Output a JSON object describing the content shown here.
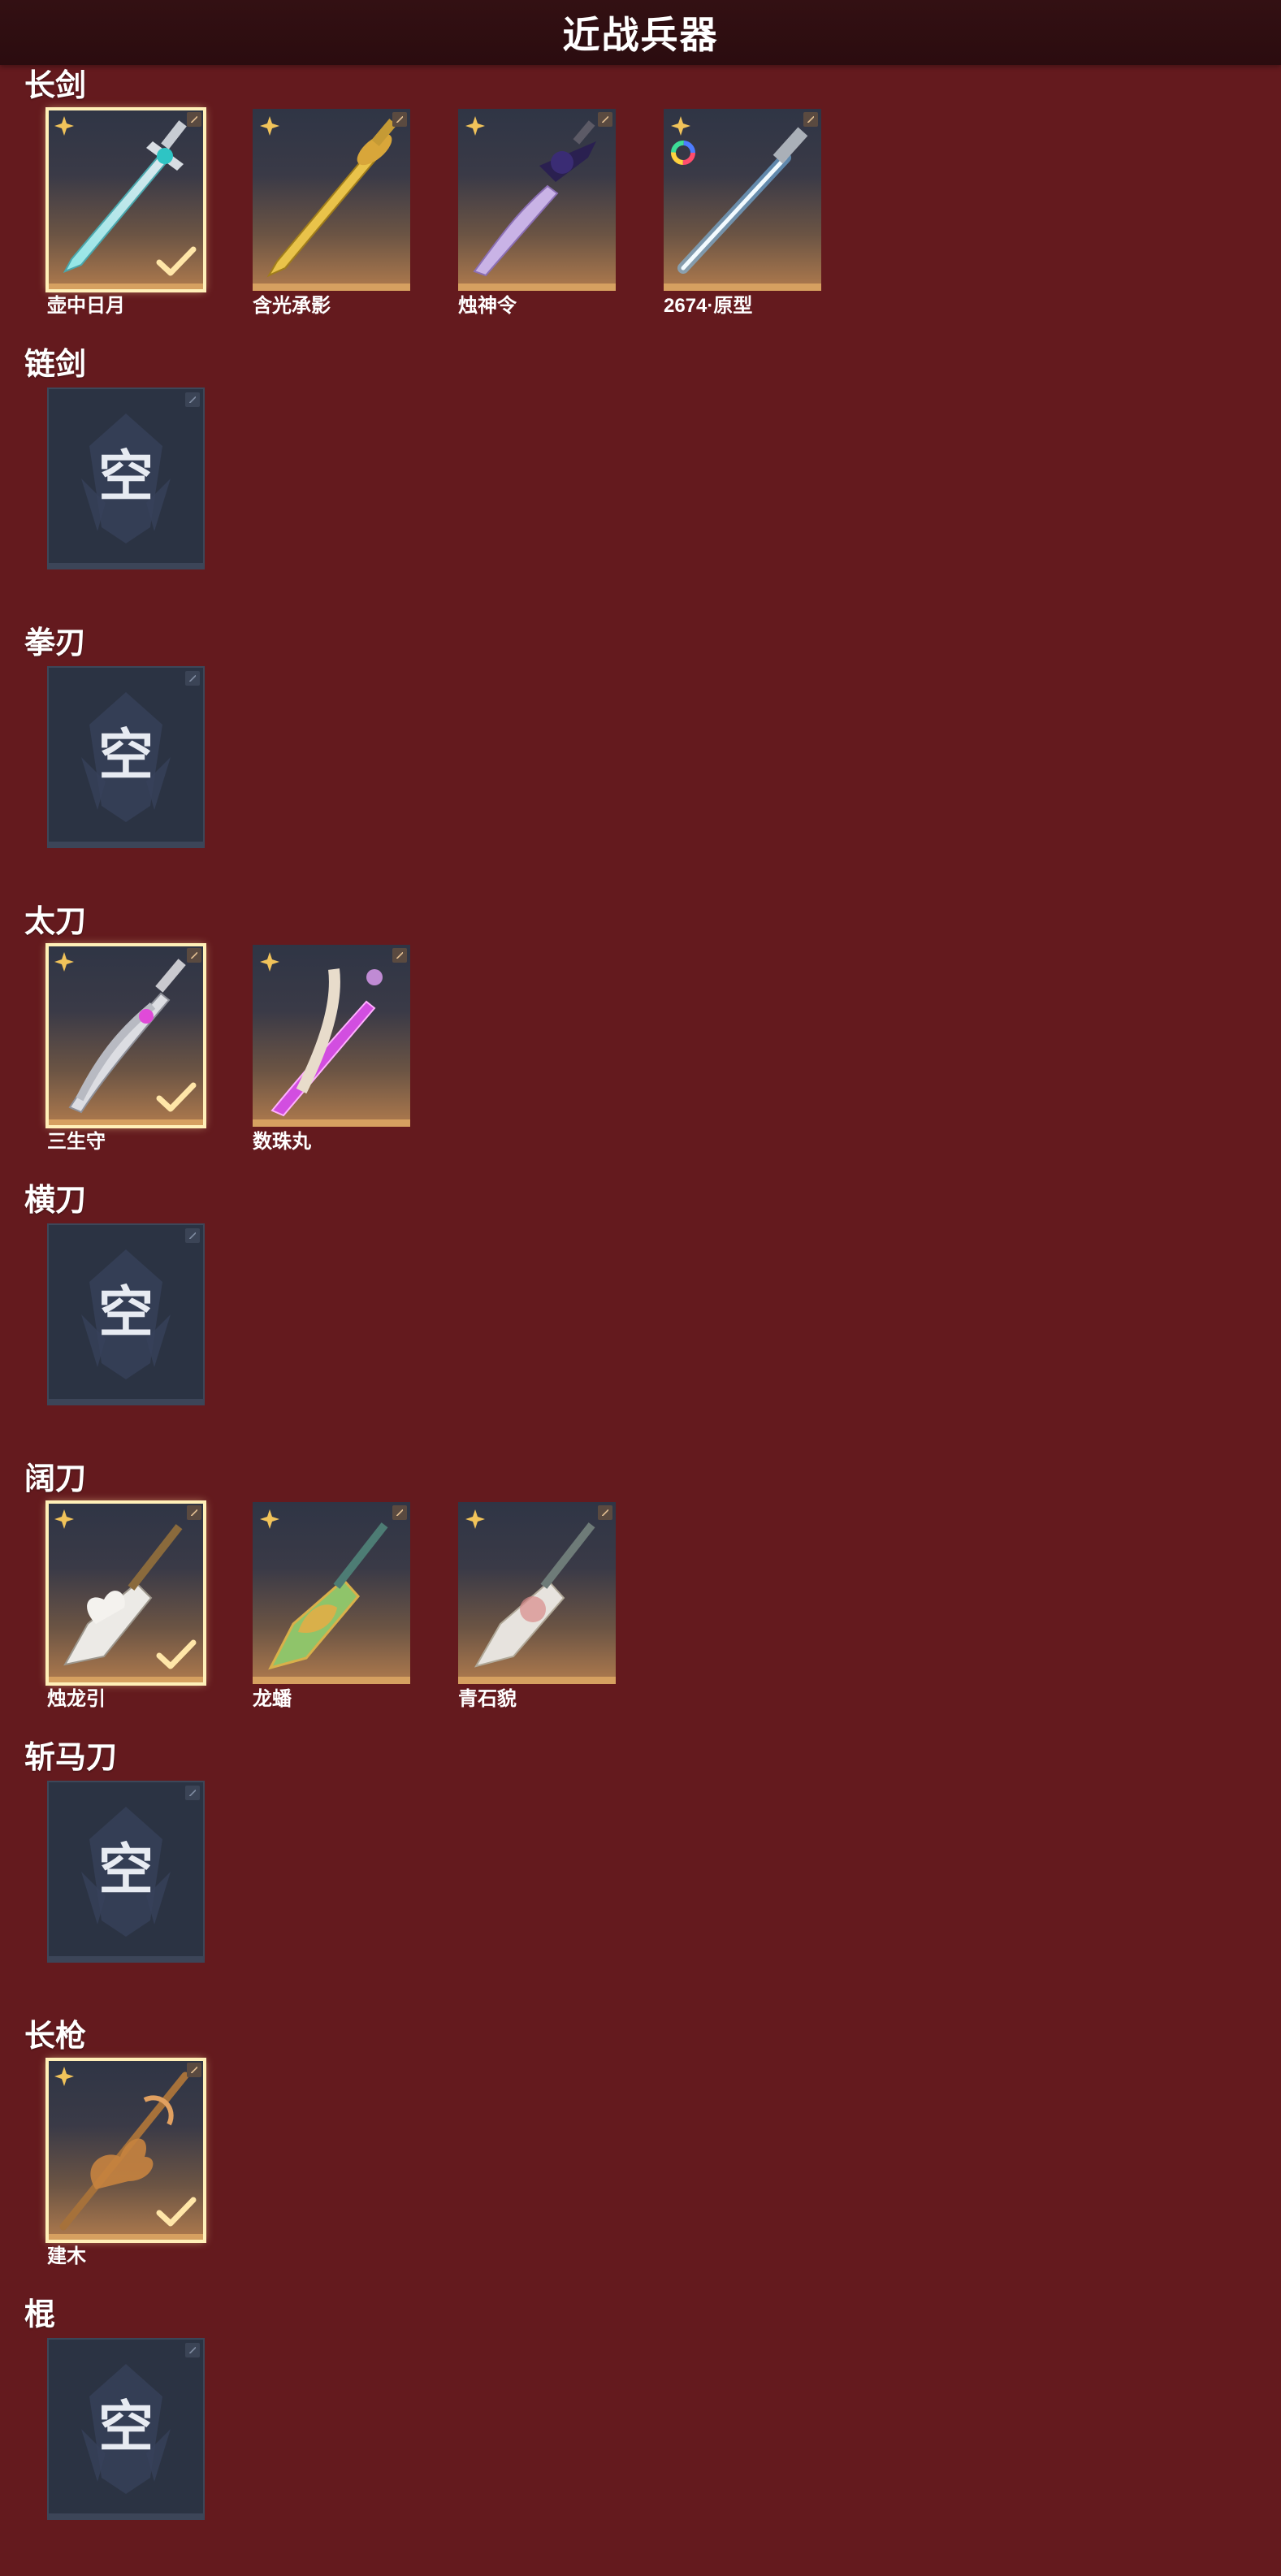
{
  "header": {
    "title": "近战兵器"
  },
  "empty_label": "空",
  "categories": [
    {
      "name": "长剑",
      "items": [
        {
          "name": "壶中日月",
          "selected": true,
          "badge": "star"
        },
        {
          "name": "含光承影",
          "selected": false,
          "badge": "star"
        },
        {
          "name": "烛神令",
          "selected": false,
          "badge": "star"
        },
        {
          "name": "2674·原型",
          "selected": false,
          "badge": "star-ring"
        }
      ]
    },
    {
      "name": "链剑",
      "items": []
    },
    {
      "name": "拳刃",
      "items": []
    },
    {
      "name": "太刀",
      "items": [
        {
          "name": "三生守",
          "selected": true,
          "badge": "star"
        },
        {
          "name": "数珠丸",
          "selected": false,
          "badge": "star"
        }
      ]
    },
    {
      "name": "横刀",
      "items": []
    },
    {
      "name": "阔刀",
      "items": [
        {
          "name": "烛龙引",
          "selected": true,
          "badge": "star"
        },
        {
          "name": "龙蟠",
          "selected": false,
          "badge": "star"
        },
        {
          "name": "青石貌",
          "selected": false,
          "badge": "star"
        }
      ]
    },
    {
      "name": "斩马刀",
      "items": []
    },
    {
      "name": "长枪",
      "items": [
        {
          "name": "建木",
          "selected": true,
          "badge": "star"
        }
      ]
    },
    {
      "name": "棍",
      "items": []
    }
  ],
  "colors": {
    "background": "#641a1e",
    "header": "#2b0c0f",
    "card_accent": "#d6a060",
    "selected_outline": "#fff0b8",
    "empty_card": "#2b3343"
  },
  "icons": {
    "badge": "four-point-star-icon",
    "ring": "color-ring-icon",
    "selected": "check-icon",
    "corner": "lock-corner-icon",
    "empty_bg": "ghost-emblem-icon"
  }
}
